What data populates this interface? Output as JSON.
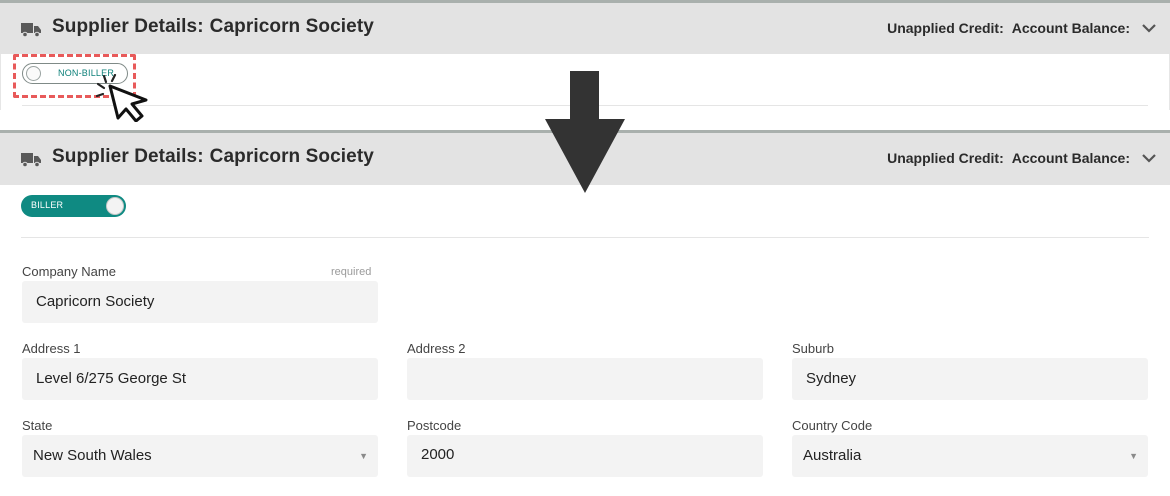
{
  "top_panel": {
    "title_prefix": "Supplier Details:",
    "title_name": "Capricorn Society",
    "unapplied_credit": "Unapplied Credit:",
    "account_balance": "Account Balance:",
    "toggle_label": "NON-BILLER"
  },
  "bottom_panel": {
    "title_prefix": "Supplier Details:",
    "title_name": "Capricorn Society",
    "unapplied_credit": "Unapplied Credit:",
    "account_balance": "Account Balance:",
    "toggle_label": "BILLER"
  },
  "form": {
    "company_name": {
      "label": "Company Name",
      "required": "required",
      "value": "Capricorn Society"
    },
    "address1": {
      "label": "Address 1",
      "value": "Level 6/275 George St"
    },
    "address2": {
      "label": "Address 2",
      "value": ""
    },
    "suburb": {
      "label": "Suburb",
      "value": "Sydney"
    },
    "state": {
      "label": "State",
      "value": "New South Wales"
    },
    "postcode": {
      "label": "Postcode",
      "value": "2000"
    },
    "country_code": {
      "label": "Country Code",
      "value": "Australia"
    }
  },
  "colors": {
    "header_bg": "#e3e3e3",
    "accent_teal": "#0f8a82",
    "highlight_red": "#e85a5a",
    "field_bg": "#f3f3f3"
  },
  "icons": [
    "truck-icon",
    "chevron-down-icon",
    "cursor-icon",
    "down-arrow-icon",
    "caret-down-icon"
  ]
}
